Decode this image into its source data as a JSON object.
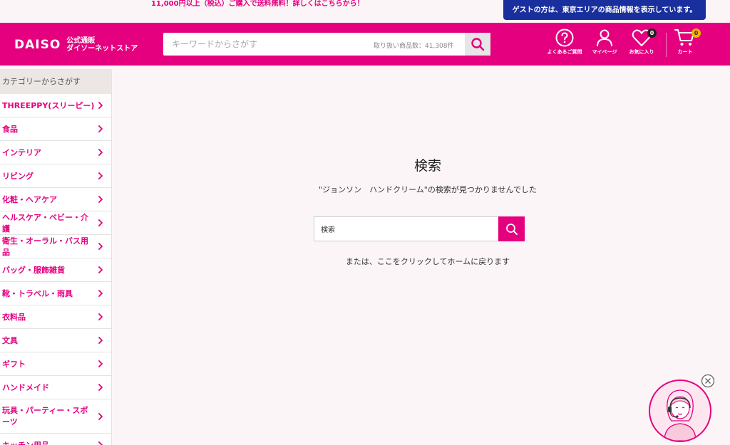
{
  "topbar": {
    "shipping_message": "11,000円以上（税込）ご購入で送料無料！詳しくはこちらから！",
    "guest_notice": "ゲストの方は、東京エリアの商品情報を表示しています。"
  },
  "header": {
    "logo_text": "DAISO",
    "logo_sub_line1": "公式通販",
    "logo_sub_line2": "ダイソーネットストア",
    "search_placeholder": "キーワードからさがす",
    "search_count": "取り扱い商品数：41,308件",
    "icons": {
      "faq_label": "よくあるご質問",
      "mypage_label": "マイページ",
      "favorites_label": "お気に入り",
      "favorites_count": "0",
      "cart_label": "カート",
      "cart_count": "0"
    }
  },
  "sidebar": {
    "title": "カテゴリーからさがす",
    "items": [
      {
        "label": "THREEPPY(スリーピー)"
      },
      {
        "label": "食品"
      },
      {
        "label": "インテリア"
      },
      {
        "label": "リビング"
      },
      {
        "label": "化粧・ヘアケア"
      },
      {
        "label": "ヘルスケア・ベビー・介護"
      },
      {
        "label": "衛生・オーラル・バス用品"
      },
      {
        "label": "バッグ・服飾雑貨"
      },
      {
        "label": "靴・トラベル・雨具"
      },
      {
        "label": "衣料品"
      },
      {
        "label": "文具"
      },
      {
        "label": "ギフト"
      },
      {
        "label": "ハンドメイド"
      },
      {
        "label": "玩具・パーティー・スポーツ"
      },
      {
        "label": "キッチン用品"
      }
    ]
  },
  "main": {
    "title": "検索",
    "not_found_message": "\"ジョンソン　ハンドクリーム\"の検索が見つかりませんでした",
    "search_value": "検索",
    "home_link": "または、ここをクリックしてホームに戻ります"
  },
  "colors": {
    "brand_pink": "#e4007f",
    "guest_blue": "#1a2f9e",
    "page_bg": "#fcf5f7"
  }
}
